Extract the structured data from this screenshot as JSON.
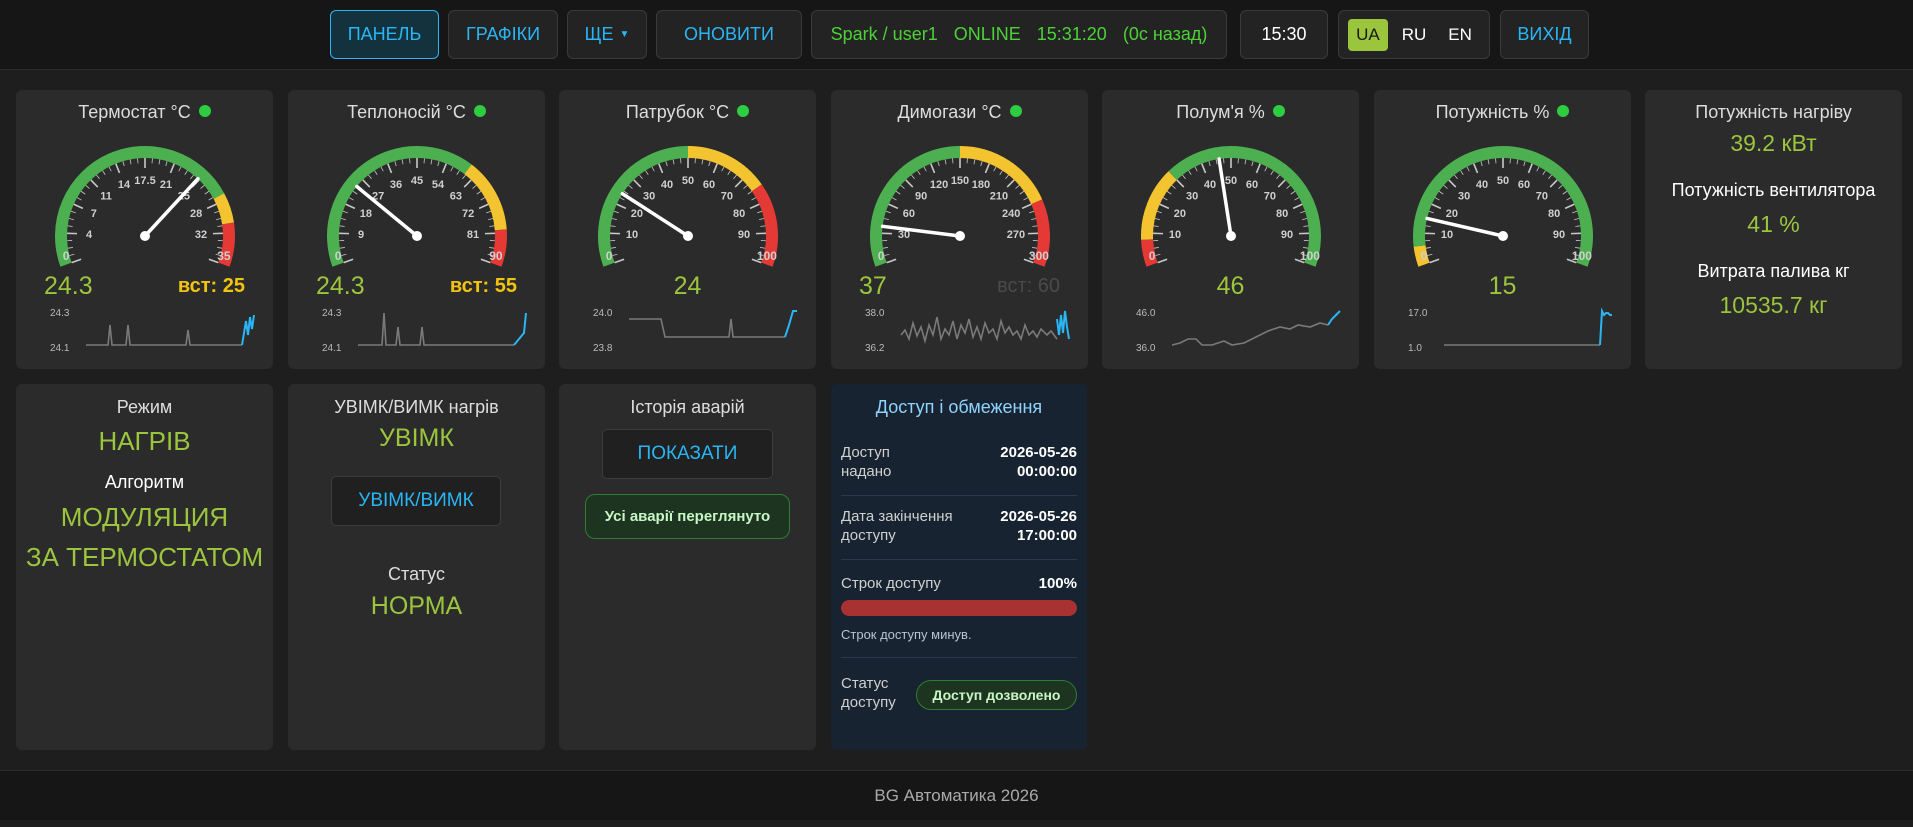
{
  "nav": {
    "panel": "ПАНЕЛЬ",
    "charts": "ГРАФІКИ",
    "more": "ЩЕ",
    "refresh": "ОНОВИТИ",
    "status": {
      "user": "Spark / user1",
      "state": "ONLINE",
      "time": "15:31:20",
      "ago": "(0с назад)"
    },
    "clock": "15:30",
    "langs": [
      "UA",
      "RU",
      "EN"
    ],
    "active_lang": "UA",
    "logout": "ВИХІД"
  },
  "gauges": [
    {
      "title": "Термостат °C",
      "min": 0,
      "max": 35,
      "value": 24.3,
      "value_label": "24.3",
      "setpoint_label": "вст: 25",
      "setpoint_dim": false,
      "ticks": [
        "0",
        "4",
        "7",
        "11",
        "14",
        "17.5",
        "21",
        "25",
        "28",
        "32",
        "35"
      ],
      "zones": [
        {
          "from": 0,
          "to": 0.78,
          "color": "#4caf50"
        },
        {
          "from": 0.78,
          "to": 0.87,
          "color": "#f4c430"
        },
        {
          "from": 0.87,
          "to": 1,
          "color": "#e53935"
        }
      ],
      "spark": {
        "max_label": "24.3",
        "min_label": "24.1"
      }
    },
    {
      "title": "Теплоносій °C",
      "min": 0,
      "max": 90,
      "value": 24.3,
      "value_label": "24.3",
      "setpoint_label": "вст: 55",
      "setpoint_dim": false,
      "ticks": [
        "0",
        "9",
        "18",
        "27",
        "36",
        "45",
        "54",
        "63",
        "72",
        "81",
        "90"
      ],
      "zones": [
        {
          "from": 0,
          "to": 0.67,
          "color": "#4caf50"
        },
        {
          "from": 0.67,
          "to": 0.89,
          "color": "#f4c430"
        },
        {
          "from": 0.89,
          "to": 1,
          "color": "#e53935"
        }
      ],
      "spark": {
        "max_label": "24.3",
        "min_label": "24.1"
      }
    },
    {
      "title": "Патрубок °C",
      "min": 0,
      "max": 100,
      "value": 24,
      "value_label": "24",
      "setpoint_label": "",
      "setpoint_dim": false,
      "ticks": [
        "0",
        "10",
        "20",
        "30",
        "40",
        "50",
        "60",
        "70",
        "80",
        "90",
        "100"
      ],
      "zones": [
        {
          "from": 0,
          "to": 0.5,
          "color": "#4caf50"
        },
        {
          "from": 0.5,
          "to": 0.75,
          "color": "#f4c430"
        },
        {
          "from": 0.75,
          "to": 1,
          "color": "#e53935"
        }
      ],
      "spark": {
        "max_label": "24.0",
        "min_label": "23.8"
      }
    },
    {
      "title": "Димогази °C",
      "min": 0,
      "max": 300,
      "value": 37,
      "value_label": "37",
      "setpoint_label": "вст: 60",
      "setpoint_dim": true,
      "ticks": [
        "0",
        "30",
        "60",
        "90",
        "120",
        "150",
        "180",
        "210",
        "240",
        "270",
        "300"
      ],
      "zones": [
        {
          "from": 0,
          "to": 0.5,
          "color": "#4caf50"
        },
        {
          "from": 0.5,
          "to": 0.8,
          "color": "#f4c430"
        },
        {
          "from": 0.8,
          "to": 1,
          "color": "#e53935"
        }
      ],
      "spark": {
        "max_label": "38.0",
        "min_label": "36.2"
      }
    },
    {
      "title": "Полум'я %",
      "min": 0,
      "max": 100,
      "value": 46,
      "value_label": "46",
      "setpoint_label": "",
      "setpoint_dim": false,
      "ticks": [
        "0",
        "10",
        "20",
        "30",
        "40",
        "50",
        "60",
        "70",
        "80",
        "90",
        "100"
      ],
      "zones": [
        {
          "from": 0,
          "to": 0.08,
          "color": "#e53935"
        },
        {
          "from": 0.08,
          "to": 0.3,
          "color": "#f4c430"
        },
        {
          "from": 0.3,
          "to": 1,
          "color": "#4caf50"
        }
      ],
      "spark": {
        "max_label": "46.0",
        "min_label": "36.0"
      }
    },
    {
      "title": "Потужність %",
      "min": 0,
      "max": 100,
      "value": 15,
      "value_label": "15",
      "setpoint_label": "",
      "setpoint_dim": false,
      "ticks": [
        "0",
        "10",
        "20",
        "30",
        "40",
        "50",
        "60",
        "70",
        "80",
        "90",
        "100"
      ],
      "zones": [
        {
          "from": 0,
          "to": 0.06,
          "color": "#f4c430"
        },
        {
          "from": 0.06,
          "to": 1,
          "color": "#4caf50"
        }
      ],
      "spark": {
        "max_label": "17.0",
        "min_label": "1.0"
      }
    }
  ],
  "power": {
    "heat_label": "Потужність нагріву",
    "heat_value": "39.2 кВт",
    "fan_label": "Потужність вентилятора",
    "fan_value": "41 %",
    "fuel_label": "Витрата палива кг",
    "fuel_value": "10535.7 кг"
  },
  "mode": {
    "label": "Режим",
    "value": "НАГРІВ",
    "algo_label": "Алгоритм",
    "algo_line1": "МОДУЛЯЦИЯ",
    "algo_line2": "ЗА ТЕРМОСТАТОМ"
  },
  "onoff": {
    "label": "УВІМК/ВИМК нагрів",
    "value": "УВІМК",
    "button": "УВІМК/ВИМК",
    "status_label": "Статус",
    "status_value": "НОРМА"
  },
  "alarms": {
    "label": "Історія аварій",
    "button": "ПОКАЗАТИ",
    "badge": "Усі аварії переглянуто"
  },
  "access": {
    "title": "Доступ і обмеження",
    "granted_label_1": "Доступ",
    "granted_label_2": "надано",
    "granted_date": "2026-05-26",
    "granted_time": "00:00:00",
    "end_label_1": "Дата закінчення",
    "end_label_2": "доступу",
    "end_date": "2026-05-26",
    "end_time": "17:00:00",
    "term_label": "Строк доступу",
    "term_value": "100%",
    "term_fraction": 1.0,
    "term_note": "Строк доступу минув.",
    "status_label_1": "Статус",
    "status_label_2": "доступу",
    "status_value": "Доступ дозволено"
  },
  "footer": "BG Автоматика 2026",
  "colors": {
    "accent": "#29b6f6",
    "green_value": "#9bc53d",
    "online": "#4cd137",
    "setpoint": "#f1c40f"
  }
}
